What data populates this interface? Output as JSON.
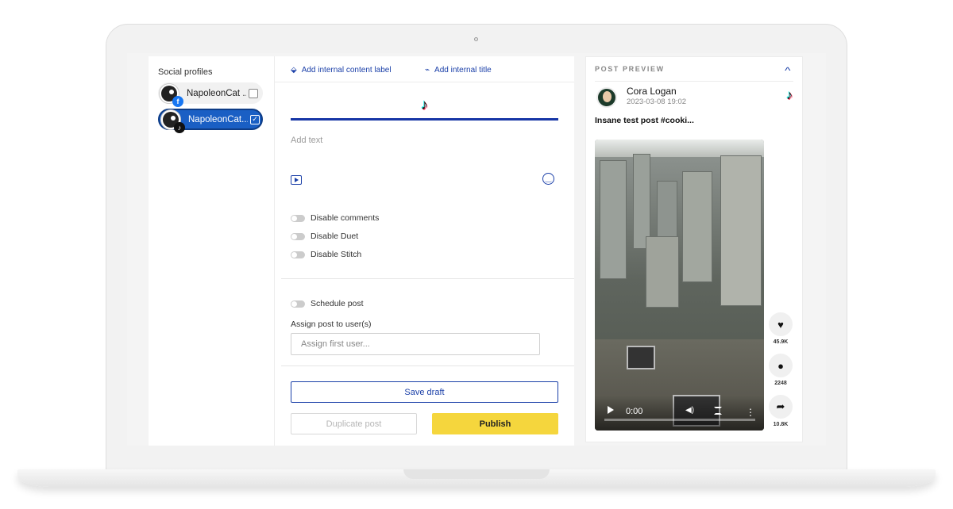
{
  "profiles": {
    "title": "Social profiles",
    "items": [
      {
        "label": "NapoleonCat ...",
        "network": "facebook",
        "selected": false
      },
      {
        "label": "NapoleonCat....",
        "network": "tiktok",
        "selected": true
      }
    ]
  },
  "editor": {
    "content_label_link": "Add internal content label",
    "title_link": "Add internal title",
    "network_tab_icon": "tiktok-icon",
    "text_placeholder": "Add text",
    "toggles": {
      "disable_comments": "Disable comments",
      "disable_duet": "Disable Duet",
      "disable_stitch": "Disable Stitch",
      "schedule_post": "Schedule post"
    },
    "assign_label": "Assign post to user(s)",
    "assign_placeholder": "Assign first user...",
    "buttons": {
      "save_draft": "Save draft",
      "duplicate": "Duplicate post",
      "publish": "Publish"
    }
  },
  "preview": {
    "title": "POST PREVIEW",
    "author": "Cora Logan",
    "timestamp": "2023-03-08 19:02",
    "caption": "Insane test post #cooki...",
    "video": {
      "time": "0:00"
    },
    "actions": {
      "likes": "45.9K",
      "comments": "2248",
      "shares": "10.8K"
    }
  },
  "colors": {
    "accent": "#1a3fa8",
    "publish": "#f5d63d",
    "selected_chip": "#1a5fc4"
  }
}
